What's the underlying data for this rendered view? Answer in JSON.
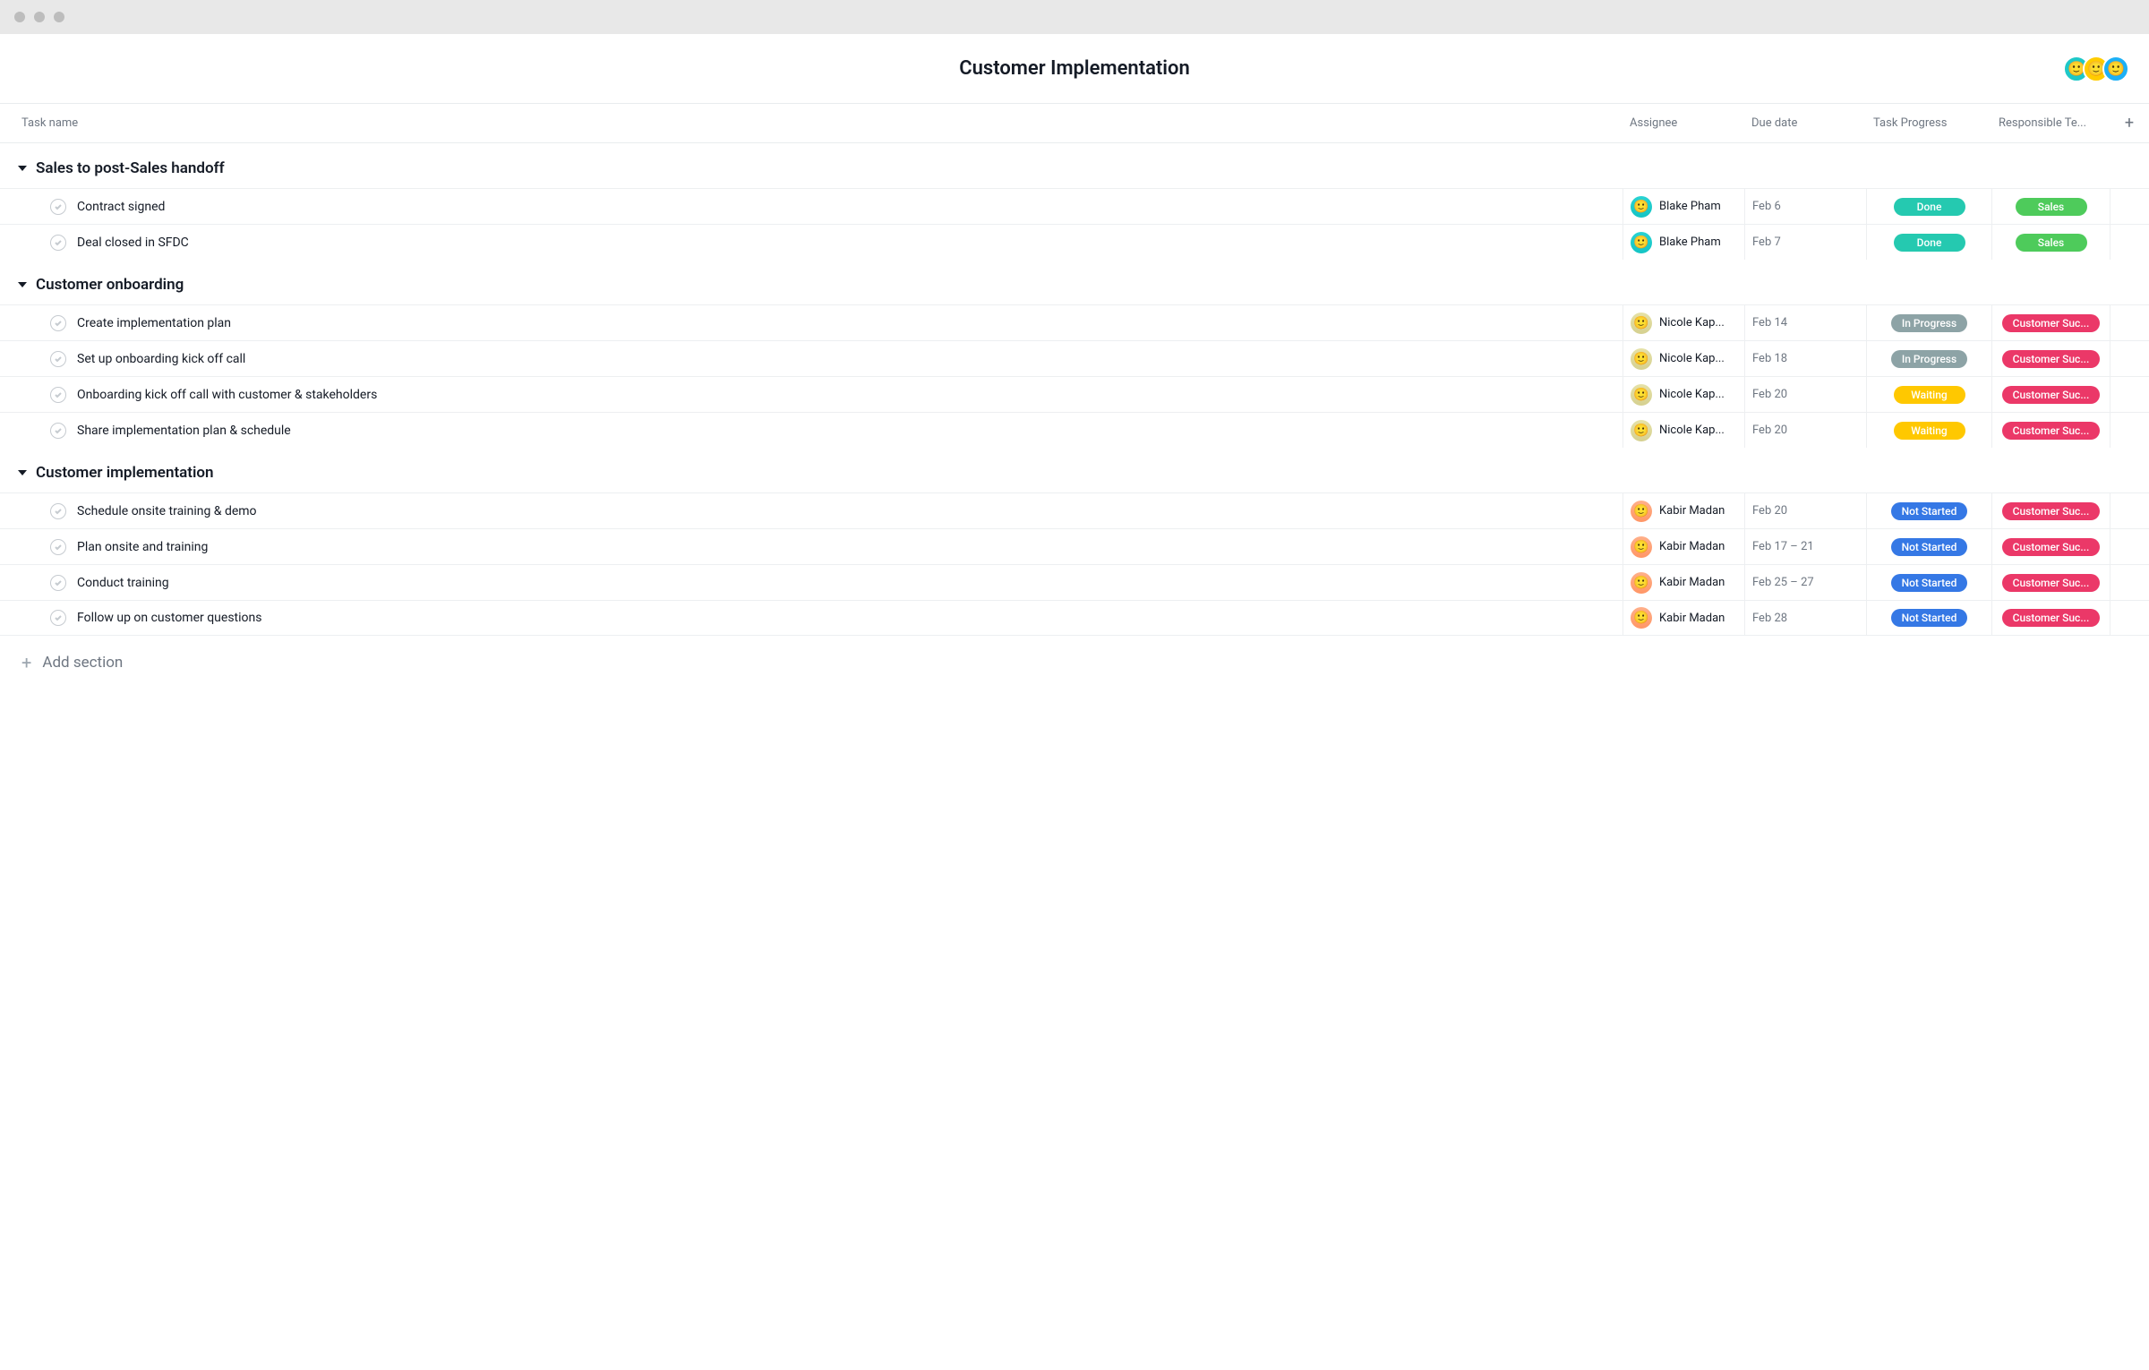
{
  "page_title": "Customer Implementation",
  "header_avatars": [
    "avatar-1",
    "avatar-2",
    "avatar-3"
  ],
  "columns": {
    "task": "Task name",
    "assignee": "Assignee",
    "due": "Due date",
    "progress": "Task Progress",
    "team": "Responsible Te..."
  },
  "progress_colors": {
    "Done": "pill-done",
    "In Progress": "pill-inprogress",
    "Waiting": "pill-waiting",
    "Not Started": "pill-notstarted"
  },
  "team_colors": {
    "Sales": "pill-sales",
    "Customer Suc...": "pill-cs"
  },
  "assignee_avatars": {
    "Blake Pham": "av-blake",
    "Nicole Kap...": "av-nicole",
    "Kabir Madan": "av-kabir"
  },
  "sections": [
    {
      "title": "Sales to post-Sales handoff",
      "tasks": [
        {
          "name": "Contract signed",
          "assignee": "Blake Pham",
          "due": "Feb 6",
          "progress": "Done",
          "team": "Sales"
        },
        {
          "name": "Deal closed in SFDC",
          "assignee": "Blake Pham",
          "due": "Feb 7",
          "progress": "Done",
          "team": "Sales"
        }
      ]
    },
    {
      "title": "Customer onboarding",
      "tasks": [
        {
          "name": "Create implementation plan",
          "assignee": "Nicole Kap...",
          "due": "Feb 14",
          "progress": "In Progress",
          "team": "Customer Suc..."
        },
        {
          "name": "Set up onboarding kick off call",
          "assignee": "Nicole Kap...",
          "due": "Feb 18",
          "progress": "In Progress",
          "team": "Customer Suc..."
        },
        {
          "name": "Onboarding kick off call with customer & stakeholders",
          "assignee": "Nicole Kap...",
          "due": "Feb 20",
          "progress": "Waiting",
          "team": "Customer Suc..."
        },
        {
          "name": "Share implementation plan & schedule",
          "assignee": "Nicole Kap...",
          "due": "Feb 20",
          "progress": "Waiting",
          "team": "Customer Suc..."
        }
      ]
    },
    {
      "title": "Customer implementation",
      "tasks": [
        {
          "name": "Schedule onsite training & demo",
          "assignee": "Kabir Madan",
          "due": "Feb 20",
          "progress": "Not Started",
          "team": "Customer Suc..."
        },
        {
          "name": "Plan onsite and training",
          "assignee": "Kabir Madan",
          "due": "Feb 17 – 21",
          "progress": "Not Started",
          "team": "Customer Suc..."
        },
        {
          "name": "Conduct training",
          "assignee": "Kabir Madan",
          "due": "Feb 25 – 27",
          "progress": "Not Started",
          "team": "Customer Suc..."
        },
        {
          "name": "Follow up on customer questions",
          "assignee": "Kabir Madan",
          "due": "Feb 28",
          "progress": "Not Started",
          "team": "Customer Suc..."
        }
      ]
    }
  ],
  "add_section_label": "Add section"
}
